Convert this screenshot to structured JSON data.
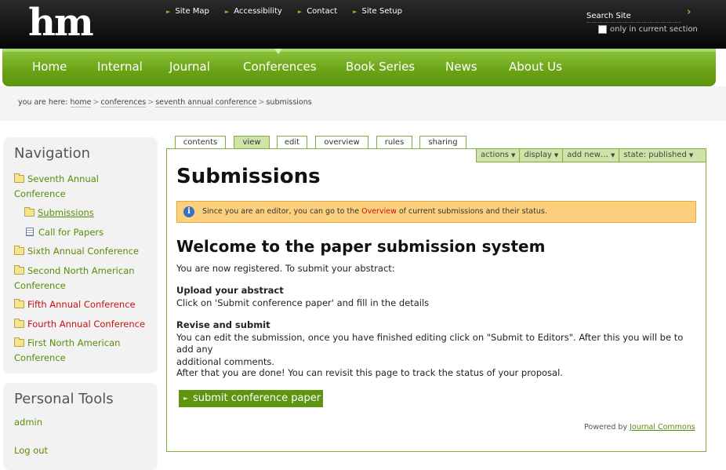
{
  "header": {
    "logo": "hm",
    "site_links": [
      "Site Map",
      "Accessibility",
      "Contact",
      "Site Setup"
    ],
    "search_placeholder": "Search Site",
    "only_current": "only in current section"
  },
  "nav": {
    "items": [
      "Home",
      "Internal",
      "Journal",
      "Conferences",
      "Book Series",
      "News",
      "About Us"
    ],
    "selected": "Conferences"
  },
  "breadcrumb": {
    "prefix": "you are here:",
    "links": [
      "home",
      "conferences",
      "seventh annual conference"
    ],
    "current": "submissions"
  },
  "navigation": {
    "title": "Navigation",
    "items": [
      {
        "label_line1": "Seventh Annual",
        "label_line2": "Conference",
        "icon": "folder-icon"
      },
      {
        "label": "Submissions",
        "icon": "folder-icon"
      },
      {
        "label": "Call for Papers",
        "icon": "document-icon"
      },
      {
        "label": "Sixth Annual Conference",
        "icon": "folder-icon"
      },
      {
        "label_line1": "Second North American",
        "label_line2": "Conference",
        "icon": "folder-icon"
      },
      {
        "label": "Fifth Annual Conference",
        "icon": "folder-icon"
      },
      {
        "label": "Fourth Annual Conference",
        "icon": "folder-icon"
      },
      {
        "label_line1": "First North American",
        "label_line2": "Conference",
        "icon": "folder-icon"
      }
    ]
  },
  "personal_tools": {
    "title": "Personal Tools",
    "items": [
      "admin",
      "Log out"
    ]
  },
  "tabs": [
    "contents",
    "view",
    "edit",
    "overview",
    "rules",
    "sharing"
  ],
  "actions": [
    "actions",
    "display",
    "add new…",
    "state: published"
  ],
  "content": {
    "title": "Submissions",
    "info_pre": "Since you are an editor, you can go to the",
    "info_link": "Overview",
    "info_post": "of current submissions and their status.",
    "heading": "Welcome to the paper submission system",
    "intro": "You are now registered. To submit your abstract:",
    "upload_title": "Upload your abstract",
    "upload_text": "Click on 'Submit conference paper' and fill in the details",
    "revise_title": "Revise and submit",
    "revise_text_1": "You can edit the submission, once you have finished editing click on \"Submit to Editors\". After this you will be to add any",
    "revise_text_2": "additional comments.",
    "done_text": "After that you are done! You can revisit this page to track the status of your proposal.",
    "submit_button": "submit conference paper",
    "powered_pre": "Powered by",
    "powered_link": "Journal Commons"
  },
  "colors": {
    "brand_green": "#6aa215",
    "link_green": "#5a8c0a",
    "info_bg": "#fdd07d"
  }
}
